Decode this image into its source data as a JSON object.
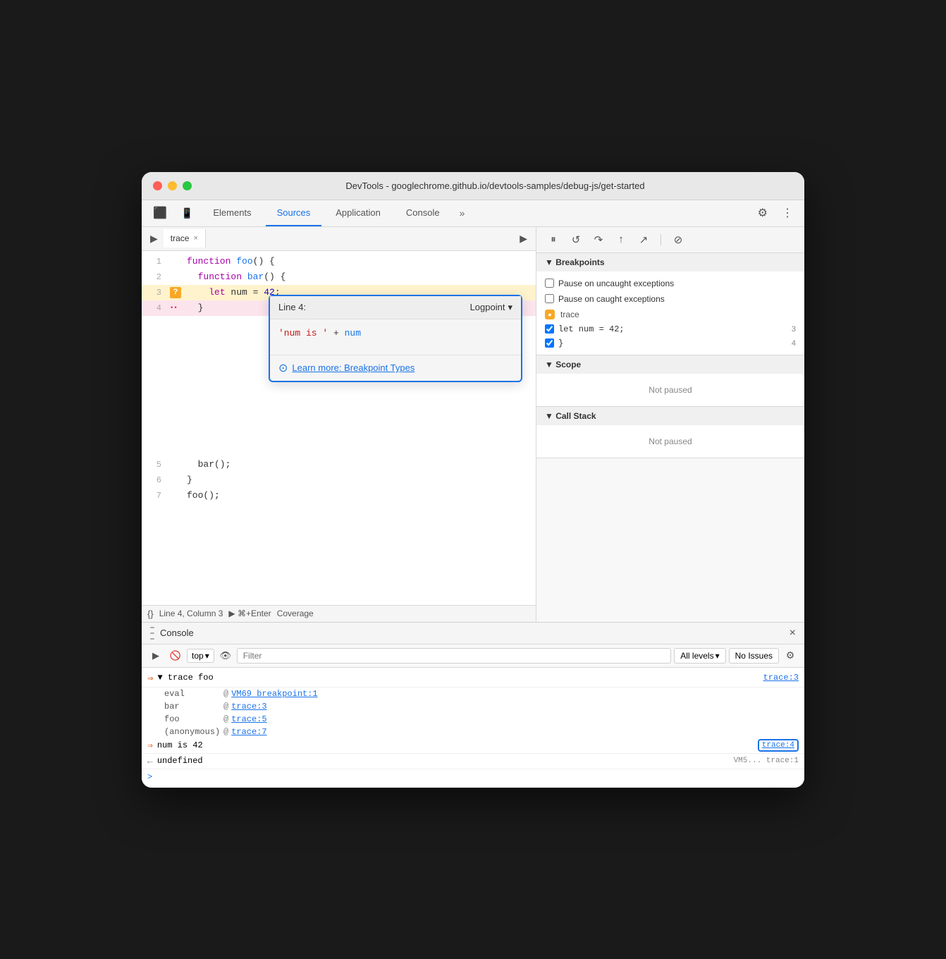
{
  "window": {
    "title": "DevTools - googlechrome.github.io/devtools-samples/debug-js/get-started",
    "traffic_lights": [
      "red",
      "yellow",
      "green"
    ]
  },
  "tabbar": {
    "tabs": [
      {
        "label": "Elements",
        "active": false
      },
      {
        "label": "Sources",
        "active": true
      },
      {
        "label": "Application",
        "active": false
      },
      {
        "label": "Console",
        "active": false
      }
    ],
    "more_label": "»"
  },
  "left_panel": {
    "file_tab": {
      "name": "trace",
      "close": "×"
    },
    "code_lines": [
      {
        "num": "1",
        "code": "function foo() {"
      },
      {
        "num": "2",
        "code": "  function bar() {"
      },
      {
        "num": "3",
        "code": "    let num = 42;",
        "highlight": "yellow",
        "bp": "question"
      },
      {
        "num": "4",
        "code": "  }",
        "highlight": "pink",
        "bp": "dots"
      },
      {
        "num": "5",
        "code": "  bar();"
      },
      {
        "num": "6",
        "code": "}"
      },
      {
        "num": "7",
        "code": "foo();"
      }
    ],
    "logpoint": {
      "line_label": "Line 4:",
      "type": "Logpoint",
      "expression": "'num is ' + num",
      "expression_str": "'num is '",
      "expression_op": " + ",
      "expression_var": "num",
      "link_text": "Learn more: Breakpoint Types",
      "link_icon": "→"
    },
    "status_bar": {
      "icon": "{}",
      "text": "Line 4, Column 3",
      "run_label": "▶ ⌘+Enter",
      "coverage": "Coverage"
    }
  },
  "right_panel": {
    "debug_toolbar": {
      "pause_btn": "⏸",
      "reload_btn": "↺",
      "step_over": "↷",
      "step_into": "↑",
      "step_out": "↗",
      "deactivate": "⊘"
    },
    "breakpoints_section": {
      "title": "▼ Breakpoints",
      "exceptions": [
        {
          "label": "Pause on uncaught exceptions",
          "checked": false
        },
        {
          "label": "Pause on caught exceptions",
          "checked": false
        }
      ],
      "source": "trace",
      "bp_items": [
        {
          "code": "let num = 42;",
          "line": "3",
          "checked": true
        },
        {
          "code": "}",
          "line": "4",
          "checked": true
        }
      ]
    },
    "scope_section": {
      "title": "▼ Scope",
      "content": "Not paused"
    },
    "callstack_section": {
      "title": "▼ Call Stack",
      "content": "Not paused"
    }
  },
  "console_panel": {
    "header_title": "Console",
    "close_label": "×",
    "toolbar": {
      "filter_placeholder": "Filter",
      "levels_label": "All levels",
      "issues_label": "No Issues",
      "top_label": "top"
    },
    "entries": [
      {
        "type": "trace",
        "content": "▼ trace foo",
        "file": "trace:3",
        "sub": [
          {
            "label": "eval",
            "at": "@",
            "link": "VM69 breakpoint:1"
          },
          {
            "label": "bar",
            "at": "@",
            "link": "trace:3"
          },
          {
            "label": "foo",
            "at": "@",
            "link": "trace:5"
          },
          {
            "label": "(anonymous)",
            "at": "@",
            "link": "trace:7"
          }
        ]
      }
    ],
    "result": {
      "icon": "⇒",
      "value": "num is 42",
      "file": "trace:4"
    },
    "undefined_result": {
      "icon": "←",
      "value": "undefined",
      "file": "VM5... trace:1"
    },
    "prompt_icon": ">"
  }
}
